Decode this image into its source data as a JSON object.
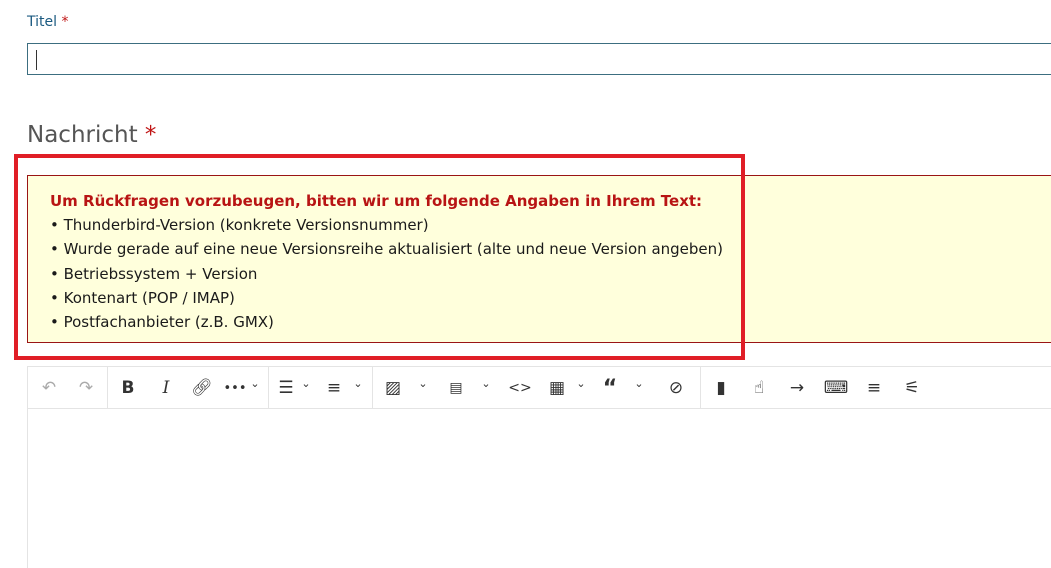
{
  "title_field": {
    "label": "Titel",
    "required_mark": "*",
    "value": ""
  },
  "message": {
    "heading": "Nachricht",
    "required_mark": "*"
  },
  "notice": {
    "title": "Um Rückfragen vorzubeugen, bitten wir um folgende Angaben in Ihrem Text:",
    "items": [
      "• Thunderbird-Version (konkrete Versionsnummer)",
      "• Wurde gerade auf eine neue Versionsreihe aktualisiert (alte und neue Version angeben)",
      "• Betriebssystem + Version",
      "• Kontenart (POP / IMAP)",
      "• Postfachanbieter (z.B. GMX)"
    ]
  },
  "colors": {
    "highlight": "#e01e26",
    "notice_bg": "#ffffdc",
    "notice_text": "#b81414",
    "label": "#1b5a80"
  },
  "toolbar": {
    "icons": [
      "undo",
      "redo",
      "bold",
      "italic",
      "link",
      "more",
      "bulleted-list",
      "align",
      "image",
      "template",
      "code",
      "table",
      "quote",
      "hide",
      "book",
      "hand",
      "arrow",
      "keyboard",
      "lines",
      "sliders"
    ]
  }
}
